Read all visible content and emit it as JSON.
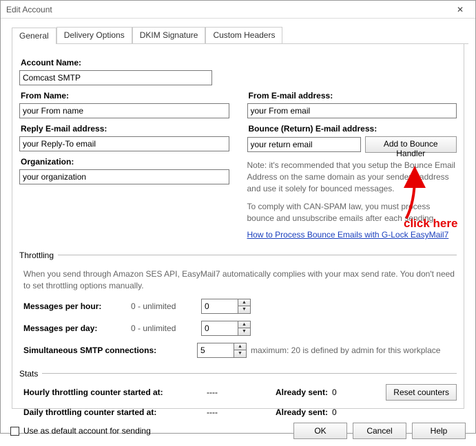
{
  "title": "Edit Account",
  "tabs": [
    "General",
    "Delivery Options",
    "DKIM Signature",
    "Custom Headers"
  ],
  "form": {
    "account_name_label": "Account Name:",
    "account_name_value": "Comcast SMTP",
    "from_name_label": "From Name:",
    "from_name_value": "your From name",
    "from_email_label": "From E-mail address:",
    "from_email_value": "your From email",
    "reply_email_label": "Reply E-mail address:",
    "reply_email_value": "your Reply-To email",
    "bounce_label": "Bounce (Return) E-mail address:",
    "bounce_value": "your return email",
    "bounce_button": "Add to Bounce Handler",
    "org_label": "Organization:",
    "org_value": "your organization",
    "note1": "Note: it's recommended that you setup the Bounce Email Address on the same domain as your sender's address and use it solely for bounced messages.",
    "note2": "To comply with CAN-SPAM law, you must process bounce and unsubscribe emails after each sending",
    "link": "How to Process Bounce Emails with G-Lock EasyMail7"
  },
  "throttling": {
    "legend": "Throttling",
    "desc": "When you send through Amazon SES API, EasyMail7 automatically complies with your max send rate. You don't need to set throttling options manually.",
    "mph_label": "Messages per hour:",
    "mph_hint": "0 - unlimited",
    "mph_value": "0",
    "mpd_label": "Messages per day:",
    "mpd_hint": "0 - unlimited",
    "mpd_value": "0",
    "smtp_label": "Simultaneous SMTP connections:",
    "smtp_value": "5",
    "smtp_note": "maximum: 20 is defined by admin for this workplace"
  },
  "stats": {
    "legend": "Stats",
    "hourly_label": "Hourly throttling counter started at:",
    "hourly_value": "----",
    "daily_label": "Daily throttling counter started at:",
    "daily_value": "----",
    "sent_label": "Already sent:",
    "hourly_sent": "0",
    "daily_sent": "0",
    "reset_button": "Reset counters"
  },
  "footer": {
    "default_label": "Use as default account for sending",
    "ok": "OK",
    "cancel": "Cancel",
    "help": "Help"
  },
  "annotation": {
    "text": "click here"
  }
}
